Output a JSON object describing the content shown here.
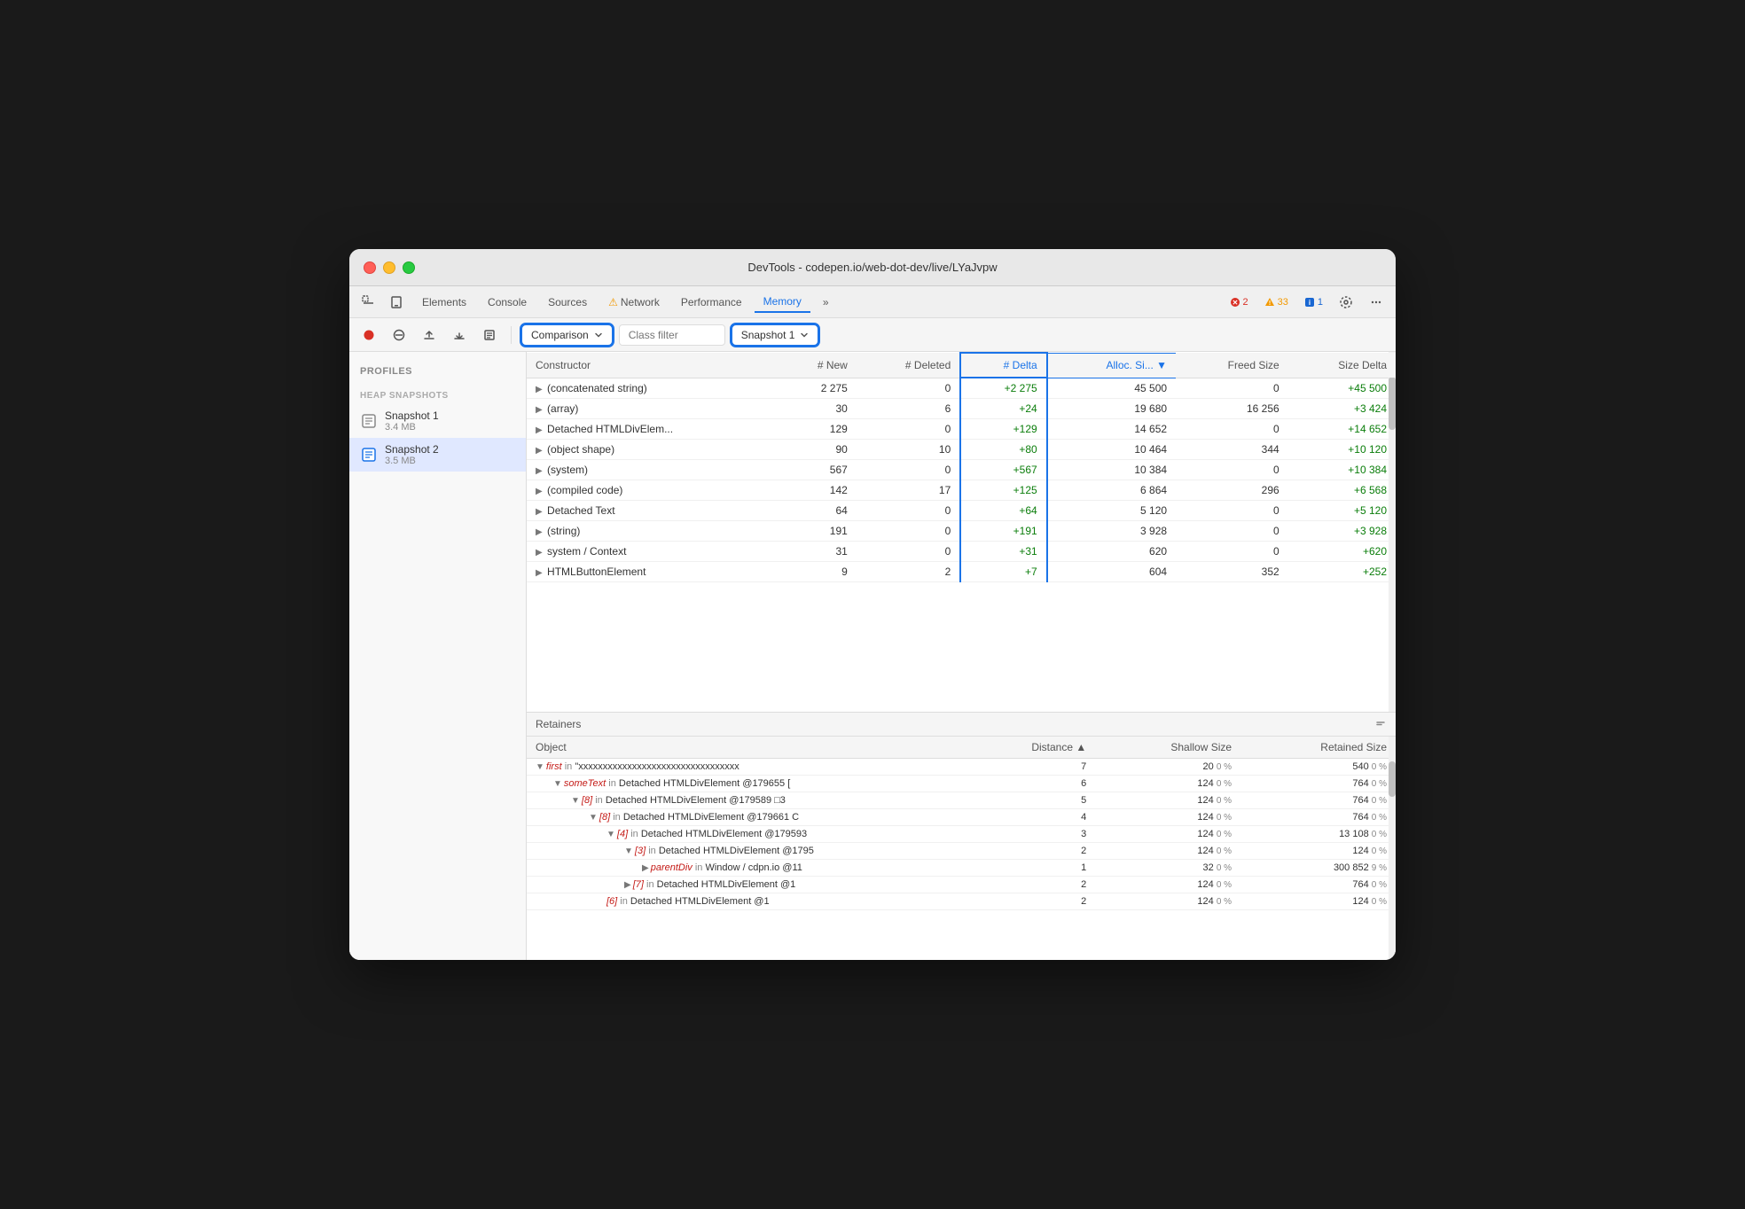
{
  "window": {
    "title": "DevTools - codepen.io/web-dot-dev/live/LYaJvpw"
  },
  "tabs": {
    "items": [
      {
        "label": "Elements",
        "active": false
      },
      {
        "label": "Console",
        "active": false
      },
      {
        "label": "Sources",
        "active": false
      },
      {
        "label": "⚠ Network",
        "active": false
      },
      {
        "label": "Performance",
        "active": false
      },
      {
        "label": "Memory",
        "active": true
      },
      {
        "label": "»",
        "active": false
      }
    ],
    "badges": {
      "error": "2",
      "warning": "33",
      "info": "1"
    }
  },
  "toolbar": {
    "comparison_label": "Comparison",
    "class_filter_placeholder": "Class filter",
    "snapshot_label": "Snapshot 1"
  },
  "sidebar": {
    "title": "Profiles",
    "heap_section": "HEAP SNAPSHOTS",
    "snapshots": [
      {
        "name": "Snapshot 1",
        "size": "3.4 MB",
        "active": false
      },
      {
        "name": "Snapshot 2",
        "size": "3.5 MB",
        "active": true
      }
    ]
  },
  "comparison_table": {
    "headers": [
      {
        "label": "Constructor",
        "key": "constructor"
      },
      {
        "label": "# New",
        "key": "new"
      },
      {
        "label": "# Deleted",
        "key": "deleted"
      },
      {
        "label": "# Delta",
        "key": "delta",
        "sorted": true
      },
      {
        "label": "Alloc. Si...",
        "key": "alloc_size",
        "sorted": true
      },
      {
        "label": "Freed Size",
        "key": "freed_size"
      },
      {
        "label": "Size Delta",
        "key": "size_delta"
      }
    ],
    "rows": [
      {
        "constructor": "(concatenated string)",
        "new": "2 275",
        "deleted": "0",
        "delta": "+2 275",
        "alloc_size": "45 500",
        "freed_size": "0",
        "size_delta": "+45 500"
      },
      {
        "constructor": "(array)",
        "new": "30",
        "deleted": "6",
        "delta": "+24",
        "alloc_size": "19 680",
        "freed_size": "16 256",
        "size_delta": "+3 424"
      },
      {
        "constructor": "Detached HTMLDivElem...",
        "new": "129",
        "deleted": "0",
        "delta": "+129",
        "alloc_size": "14 652",
        "freed_size": "0",
        "size_delta": "+14 652"
      },
      {
        "constructor": "(object shape)",
        "new": "90",
        "deleted": "10",
        "delta": "+80",
        "alloc_size": "10 464",
        "freed_size": "344",
        "size_delta": "+10 120"
      },
      {
        "constructor": "(system)",
        "new": "567",
        "deleted": "0",
        "delta": "+567",
        "alloc_size": "10 384",
        "freed_size": "0",
        "size_delta": "+10 384"
      },
      {
        "constructor": "(compiled code)",
        "new": "142",
        "deleted": "17",
        "delta": "+125",
        "alloc_size": "6 864",
        "freed_size": "296",
        "size_delta": "+6 568"
      },
      {
        "constructor": "Detached Text",
        "new": "64",
        "deleted": "0",
        "delta": "+64",
        "alloc_size": "5 120",
        "freed_size": "0",
        "size_delta": "+5 120"
      },
      {
        "constructor": "(string)",
        "new": "191",
        "deleted": "0",
        "delta": "+191",
        "alloc_size": "3 928",
        "freed_size": "0",
        "size_delta": "+3 928"
      },
      {
        "constructor": "system / Context",
        "new": "31",
        "deleted": "0",
        "delta": "+31",
        "alloc_size": "620",
        "freed_size": "0",
        "size_delta": "+620"
      },
      {
        "constructor": "HTMLButtonElement",
        "new": "9",
        "deleted": "2",
        "delta": "+7",
        "alloc_size": "604",
        "freed_size": "352",
        "size_delta": "+252"
      }
    ]
  },
  "retainers": {
    "title": "Retainers",
    "headers": [
      {
        "label": "Object"
      },
      {
        "label": "Distance",
        "sorted": true
      },
      {
        "label": "Shallow Size"
      },
      {
        "label": "Retained Size"
      }
    ],
    "rows": [
      {
        "indent": 0,
        "key": "first",
        "in_text": "in",
        "class": "\"xxxxxxxxxxxxxxxxxxxxxxxxxxxxxxxxx",
        "distance": "7",
        "shallow_size": "20",
        "shallow_pct": "0 %",
        "retained_size": "540",
        "retained_pct": "0 %",
        "arrow": "▼"
      },
      {
        "indent": 1,
        "key": "someText",
        "in_text": "in",
        "class": "Detached HTMLDivElement @179655 [",
        "distance": "6",
        "shallow_size": "124",
        "shallow_pct": "0 %",
        "retained_size": "764",
        "retained_pct": "0 %",
        "arrow": "▼"
      },
      {
        "indent": 2,
        "key": "[8]",
        "in_text": "in",
        "class": "Detached HTMLDivElement @179589 □3",
        "distance": "5",
        "shallow_size": "124",
        "shallow_pct": "0 %",
        "retained_size": "764",
        "retained_pct": "0 %",
        "arrow": "▼"
      },
      {
        "indent": 3,
        "key": "[8]",
        "in_text": "in",
        "class": "Detached HTMLDivElement @179661 C",
        "distance": "4",
        "shallow_size": "124",
        "shallow_pct": "0 %",
        "retained_size": "764",
        "retained_pct": "0 %",
        "arrow": "▼"
      },
      {
        "indent": 4,
        "key": "[4]",
        "in_text": "in",
        "class": "Detached HTMLDivElement @179593",
        "distance": "3",
        "shallow_size": "124",
        "shallow_pct": "0 %",
        "retained_size": "13 108",
        "retained_pct": "0 %",
        "arrow": "▼"
      },
      {
        "indent": 5,
        "key": "[3]",
        "in_text": "in",
        "class": "Detached HTMLDivElement @1795",
        "distance": "2",
        "shallow_size": "124",
        "shallow_pct": "0 %",
        "retained_size": "124",
        "retained_pct": "0 %",
        "arrow": "▼"
      },
      {
        "indent": 6,
        "key": "parentDiv",
        "in_text": "in",
        "class": "Window / cdpn.io @11",
        "distance": "1",
        "shallow_size": "32",
        "shallow_pct": "0 %",
        "retained_size": "300 852",
        "retained_pct": "9 %",
        "arrow": "▶"
      },
      {
        "indent": 5,
        "key": "[7]",
        "in_text": "in",
        "class": "Detached HTMLDivElement @1",
        "distance": "2",
        "shallow_size": "124",
        "shallow_pct": "0 %",
        "retained_size": "764",
        "retained_pct": "0 %",
        "arrow": "▶"
      },
      {
        "indent": 4,
        "key": "[6]",
        "in_text": "in",
        "class": "Detached HTMLDivElement @1",
        "distance": "2",
        "shallow_size": "124",
        "shallow_pct": "0 %",
        "retained_size": "124",
        "retained_pct": "0 %",
        "arrow": ""
      }
    ]
  }
}
